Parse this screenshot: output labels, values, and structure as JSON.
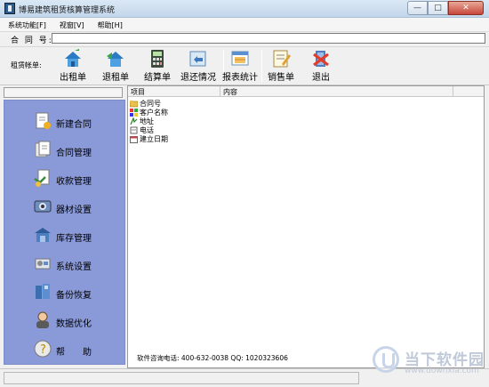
{
  "window": {
    "title": "博易建筑租赁核算管理系统"
  },
  "menu": [
    {
      "label": "系统功能[F]"
    },
    {
      "label": "视窗[V]"
    },
    {
      "label": "帮助[H]"
    }
  ],
  "contract": {
    "label": "合 同 号:",
    "value": ""
  },
  "toolbar": {
    "label": "租赁帐单:",
    "buttons": [
      {
        "label": "出租单",
        "icon": "house-upload-icon"
      },
      {
        "label": "退租单",
        "icon": "house-return-icon"
      },
      {
        "label": "结算单",
        "icon": "calculator-icon"
      },
      {
        "label": "退还情况",
        "icon": "return-status-icon"
      },
      {
        "label": "报表统计",
        "icon": "report-icon"
      },
      {
        "label": "销售单",
        "icon": "sales-note-icon"
      },
      {
        "label": "退出",
        "icon": "exit-icon"
      }
    ]
  },
  "sidebar": {
    "items": [
      {
        "label": "新建合同",
        "icon": "new-contract-icon"
      },
      {
        "label": "合同管理",
        "icon": "contract-manage-icon"
      },
      {
        "label": "收款管理",
        "icon": "payment-icon"
      },
      {
        "label": "器材设置",
        "icon": "equipment-icon"
      },
      {
        "label": "库存管理",
        "icon": "warehouse-icon"
      },
      {
        "label": "系统设置",
        "icon": "settings-icon"
      },
      {
        "label": "备份恢复",
        "icon": "backup-icon"
      },
      {
        "label": "数据优化",
        "icon": "optimize-icon"
      },
      {
        "label": "帮　　助",
        "icon": "help-icon"
      }
    ]
  },
  "table": {
    "columns": [
      "项目",
      "内容"
    ],
    "rows": [
      {
        "label": "合同号",
        "icon": "folder-icon"
      },
      {
        "label": "客户名称",
        "icon": "client-icon"
      },
      {
        "label": "地址",
        "icon": "address-icon"
      },
      {
        "label": "电话",
        "icon": "phone-icon"
      },
      {
        "label": "建立日期",
        "icon": "calendar-icon"
      }
    ]
  },
  "footer": {
    "info": "软件咨询电话: 400-632-0038   QQ: 1020323606"
  },
  "watermark": {
    "title": "当下软件园",
    "url": "www.downxia.com"
  },
  "colors": {
    "sidebar": "#8a9ad8",
    "titlebar": "#c3d6ea",
    "close": "#c7463a"
  }
}
